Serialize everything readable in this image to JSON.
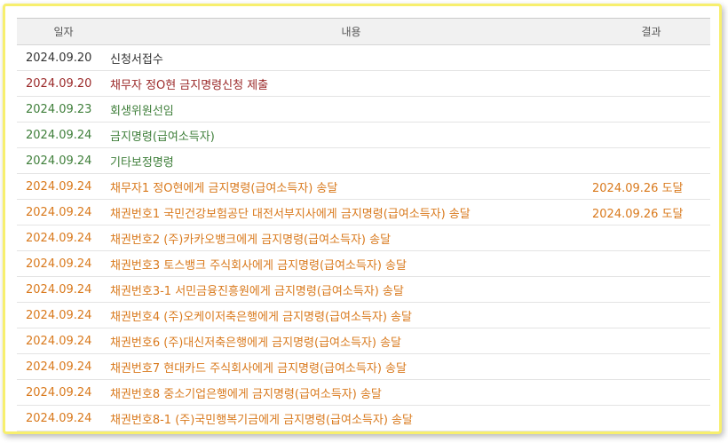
{
  "table": {
    "headers": [
      "일자",
      "내용",
      "결과"
    ],
    "rows": [
      {
        "date": "2024.09.20",
        "content": "신청서접수",
        "result": "",
        "color": "#333333"
      },
      {
        "date": "2024.09.20",
        "content": "채무자 정O현 금지명령신청 제출",
        "result": "",
        "color": "#9b2a2a"
      },
      {
        "date": "2024.09.23",
        "content": "회생위원선임",
        "result": "",
        "color": "#3f7f3a"
      },
      {
        "date": "2024.09.24",
        "content": "금지명령(급여소득자)",
        "result": "",
        "color": "#3f7f3a"
      },
      {
        "date": "2024.09.24",
        "content": "기타보정명령",
        "result": "",
        "color": "#3f7f3a"
      },
      {
        "date": "2024.09.24",
        "content": "채무자1 정O현에게 금지명령(급여소득자) 송달",
        "result": "2024.09.26 도달",
        "color": "#d9791c"
      },
      {
        "date": "2024.09.24",
        "content": "채권번호1 국민건강보험공단 대전서부지사에게 금지명령(급여소득자) 송달",
        "result": "2024.09.26 도달",
        "color": "#d9791c"
      },
      {
        "date": "2024.09.24",
        "content": "채권번호2 (주)카카오뱅크에게 금지명령(급여소득자) 송달",
        "result": "",
        "color": "#d9791c"
      },
      {
        "date": "2024.09.24",
        "content": "채권번호3 토스뱅크 주식회사에게 금지명령(급여소득자) 송달",
        "result": "",
        "color": "#d9791c"
      },
      {
        "date": "2024.09.24",
        "content": "채권번호3-1 서민금융진흥원에게 금지명령(급여소득자) 송달",
        "result": "",
        "color": "#d9791c"
      },
      {
        "date": "2024.09.24",
        "content": "채권번호4 (주)오케이저축은행에게 금지명령(급여소득자) 송달",
        "result": "",
        "color": "#d9791c"
      },
      {
        "date": "2024.09.24",
        "content": "채권번호6 (주)대신저축은행에게 금지명령(급여소득자) 송달",
        "result": "",
        "color": "#d9791c"
      },
      {
        "date": "2024.09.24",
        "content": "채권번호7 현대카드 주식회사에게 금지명령(급여소득자) 송달",
        "result": "",
        "color": "#d9791c"
      },
      {
        "date": "2024.09.24",
        "content": "채권번호8 중소기업은행에게 금지명령(급여소득자) 송달",
        "result": "",
        "color": "#d9791c"
      },
      {
        "date": "2024.09.24",
        "content": "채권번호8-1 (주)국민행복기금에게 금지명령(급여소득자) 송달",
        "result": "",
        "color": "#d9791c"
      }
    ]
  }
}
